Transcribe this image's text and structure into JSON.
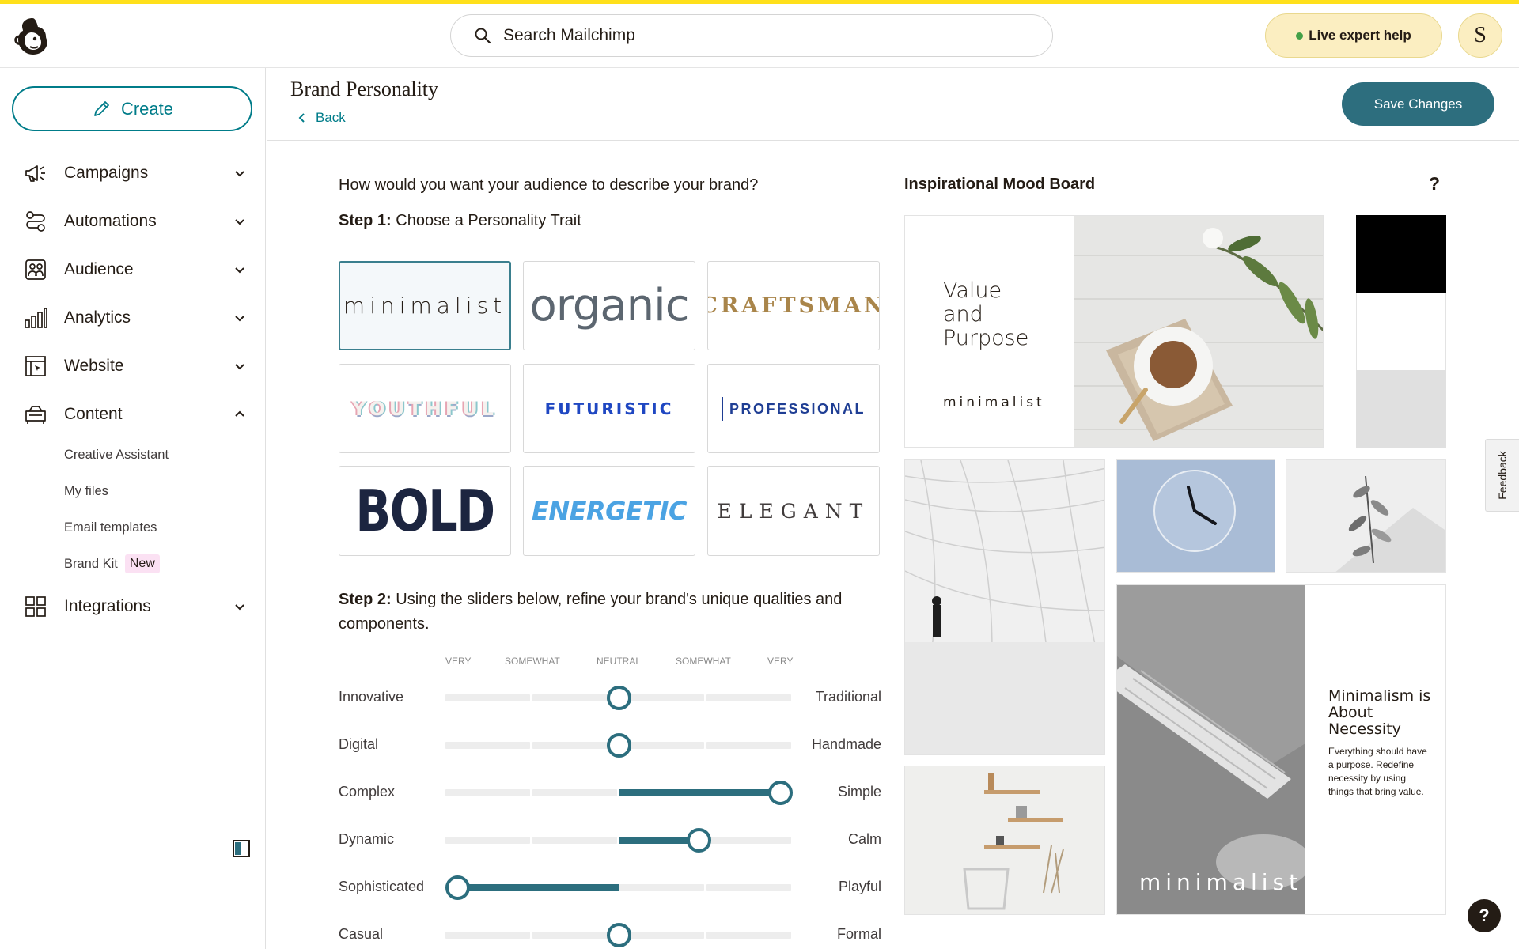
{
  "topbar": {
    "search_placeholder": "Search Mailchimp",
    "help_label": "Live expert help",
    "avatar_initial": "S"
  },
  "sidebar": {
    "create_label": "Create",
    "items": [
      {
        "label": "Campaigns",
        "icon": "megaphone-icon"
      },
      {
        "label": "Automations",
        "icon": "automations-icon"
      },
      {
        "label": "Audience",
        "icon": "audience-icon"
      },
      {
        "label": "Analytics",
        "icon": "bar-chart-icon"
      },
      {
        "label": "Website",
        "icon": "website-icon"
      },
      {
        "label": "Content",
        "icon": "content-icon",
        "expanded": true
      },
      {
        "label": "Integrations",
        "icon": "grid-icon"
      }
    ],
    "content_sub": [
      "Creative Assistant",
      "My files",
      "Email templates",
      "Brand Kit"
    ],
    "new_badge": "New"
  },
  "header": {
    "title": "Brand Personality",
    "back_label": "Back",
    "save_label": "Save Changes"
  },
  "personality": {
    "question": "How would you want your audience to describe your brand?",
    "step1_label": "Step 1:",
    "step1_text": "Choose a Personality Trait",
    "traits": [
      "minimalist",
      "organic",
      "CRAFTSMAN",
      "YOUTHFUL",
      "FUTURISTIC",
      "PROFESSIONAL",
      "BOLD",
      "ENERGETIC",
      "ELEGANT"
    ],
    "selected_trait": "minimalist",
    "step2_label": "Step 2:",
    "step2_text": "Using the sliders below, refine your brand's unique qualities and components.",
    "scale": [
      "VERY",
      "SOMEWHAT",
      "NEUTRAL",
      "SOMEWHAT",
      "VERY"
    ],
    "sliders": [
      {
        "left": "Innovative",
        "right": "Traditional",
        "value": 0.5
      },
      {
        "left": "Digital",
        "right": "Handmade",
        "value": 0.5
      },
      {
        "left": "Complex",
        "right": "Simple",
        "value": 0.965
      },
      {
        "left": "Dynamic",
        "right": "Calm",
        "value": 0.73
      },
      {
        "left": "Sophisticated",
        "right": "Playful",
        "value": 0.035
      },
      {
        "left": "Casual",
        "right": "Formal",
        "value": 0.5
      }
    ]
  },
  "moodboard": {
    "title": "Inspirational Mood Board",
    "help": "?",
    "tile1_lines": [
      "Value",
      "and",
      "Purpose"
    ],
    "tile1_word": "minimalist",
    "swatches": [
      "#000000",
      "#ffffff",
      "#e0e0e0"
    ],
    "tile_big_word": "minimalist",
    "tile_big_heading": "Minimalism is About Necessity",
    "tile_big_body": "Everything should have a purpose. Redefine necessity by using things that bring value."
  },
  "widgets": {
    "feedback_label": "Feedback",
    "help_fab": "?"
  },
  "colors": {
    "accent_yellow": "#ffe01b",
    "brand_teal": "#007c89",
    "slider_teal": "#2c6e7e"
  }
}
